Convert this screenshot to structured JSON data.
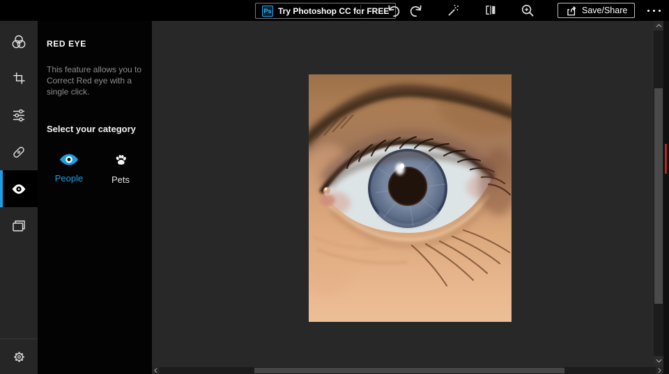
{
  "topbar": {
    "ps_badge": "Ps",
    "try_label": "Try Photoshop CC for FREE",
    "save_share_label": "Save/Share",
    "icons": [
      "undo-icon",
      "redo-icon",
      "auto-enhance-wand-icon",
      "compare-icon",
      "zoom-icon",
      "share-icon",
      "more-ellipsis-icon"
    ]
  },
  "panel": {
    "title": "RED EYE",
    "description": "This feature allows you to Correct Red eye with a single click.",
    "category_heading": "Select your category",
    "categories": [
      {
        "label": "People",
        "icon": "eye-icon",
        "selected": true
      },
      {
        "label": "Pets",
        "icon": "paw-icon",
        "selected": false
      }
    ]
  },
  "sidebar": {
    "tools": [
      {
        "name": "looks",
        "icon": "color-circles-icon",
        "selected": false
      },
      {
        "name": "crop",
        "icon": "crop-icon",
        "selected": false
      },
      {
        "name": "adjustments",
        "icon": "sliders-icon",
        "selected": false
      },
      {
        "name": "heal",
        "icon": "bandaid-icon",
        "selected": false
      },
      {
        "name": "red-eye",
        "icon": "eye-icon",
        "selected": true
      },
      {
        "name": "borders",
        "icon": "frames-icon",
        "selected": false
      }
    ],
    "settings_icon": "gear-icon"
  },
  "canvas": {
    "content": "close-up photo of a human eye with blue iris",
    "scrollbar_icons": [
      "chevron-up-icon",
      "chevron-down-icon",
      "chevron-left-icon",
      "chevron-right-icon"
    ]
  },
  "colors": {
    "accent_blue": "#1e9ee2",
    "ps_badge_blue": "#31a8ff",
    "scroll_marker_red": "#b2271e"
  }
}
